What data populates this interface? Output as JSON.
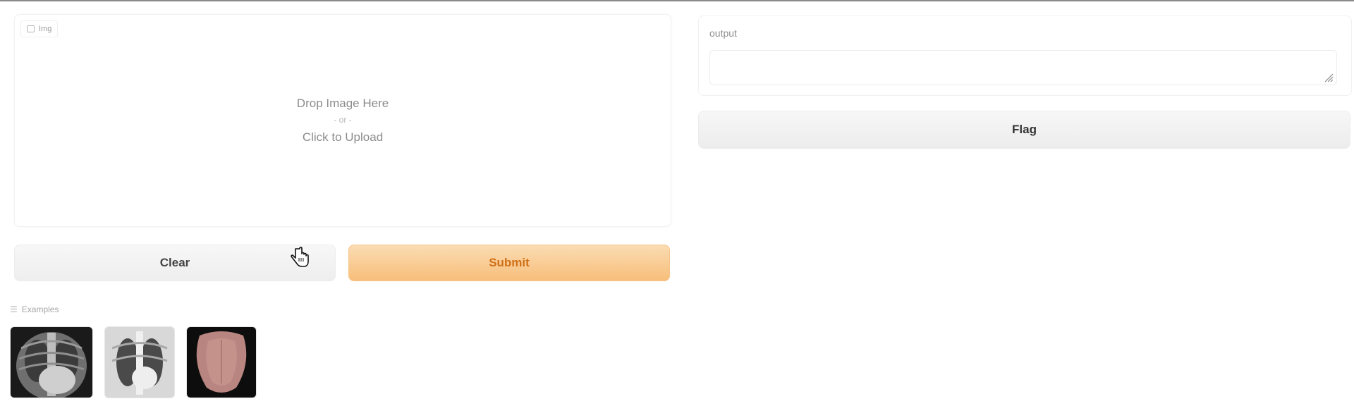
{
  "input_panel": {
    "label": "Img",
    "drop_text": "Drop Image Here",
    "or_text": "- or -",
    "click_text": "Click to Upload"
  },
  "buttons": {
    "clear_label": "Clear",
    "submit_label": "Submit",
    "flag_label": "Flag"
  },
  "examples": {
    "label": "Examples",
    "items": [
      {
        "name": "example-xray-1"
      },
      {
        "name": "example-xray-2"
      },
      {
        "name": "example-tongue"
      }
    ]
  },
  "output_panel": {
    "label": "output",
    "value": ""
  },
  "colors": {
    "submit_bg": "#f7be7a",
    "submit_text": "#d07018",
    "neutral_button": "#eeeeee"
  }
}
